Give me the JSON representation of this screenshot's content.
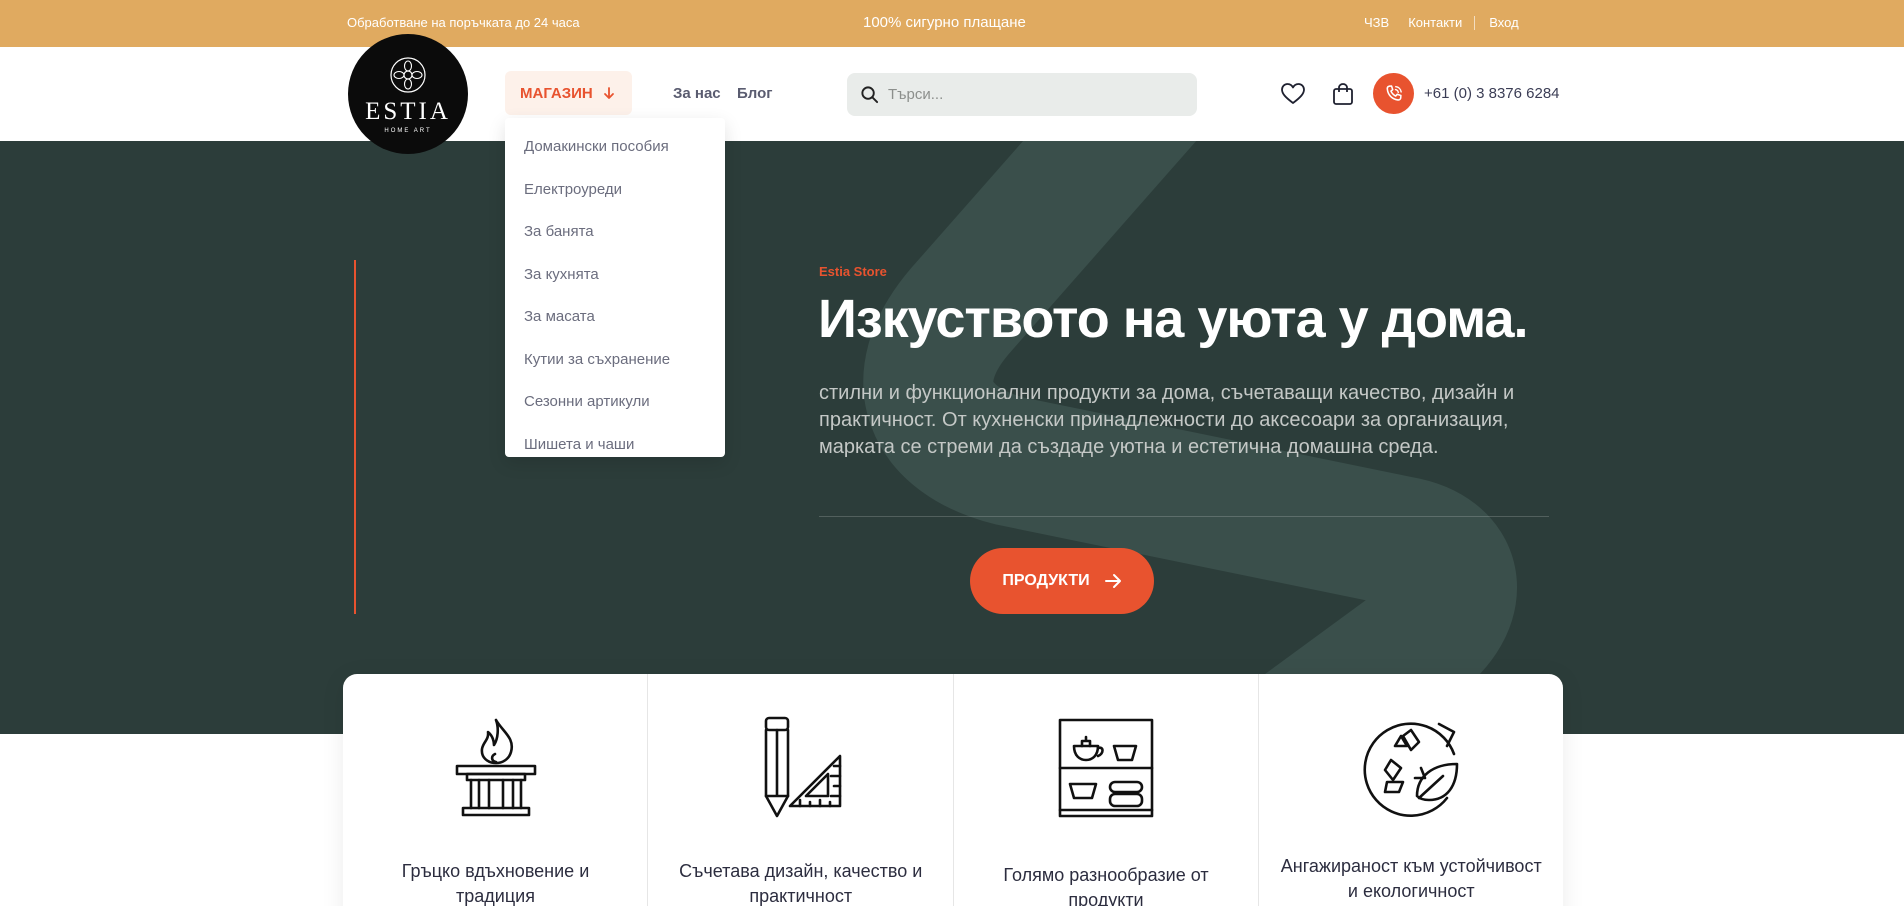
{
  "topbar": {
    "processing": "Обработване на поръчката до 24 часа",
    "secure_payment": "100% сигурно плащане",
    "faq": "ЧЗВ",
    "contacts": "Контакти",
    "login": "Вход"
  },
  "logo": {
    "name": "ESTIA",
    "tagline": "HOME ART"
  },
  "nav": {
    "shop": "МАГАЗИН",
    "about": "За нас",
    "blog": "Блог"
  },
  "search": {
    "placeholder": "Търси..."
  },
  "contact": {
    "phone": "+61 (0) 3 8376 6284"
  },
  "shop_menu": {
    "items": [
      "Домакински пособия",
      "Електроуреди",
      "За банята",
      "За кухнята",
      "За масата",
      "Кутии за съхранение",
      "Сезонни артикули",
      "Шишета и чаши"
    ]
  },
  "hero": {
    "eyebrow": "Estia Store",
    "title": "Изкуството на уюта у дома.",
    "description": "стилни и функционални продукти за дома, съчетаващи качество, дизайн и практичност. От кухненски принадлежности до аксесоари за организация, марката се стреми да създаде уютна и естетична домашна среда.",
    "cta": "ПРОДУКТИ"
  },
  "features": [
    {
      "icon": "fire-altar-icon",
      "text": "Гръцко вдъхновение и традиция"
    },
    {
      "icon": "pencil-ruler-icon",
      "text": "Съчетава дизайн, качество и практичност"
    },
    {
      "icon": "shelf-products-icon",
      "text": "Голямо разнообразие от продукти"
    },
    {
      "icon": "recycle-leaf-icon",
      "text": "Ангажираност към устойчивост и екологичност"
    }
  ],
  "colors": {
    "accent": "#e8532f",
    "topbar": "#e0aa60",
    "hero_bg": "#2c3d3a"
  }
}
